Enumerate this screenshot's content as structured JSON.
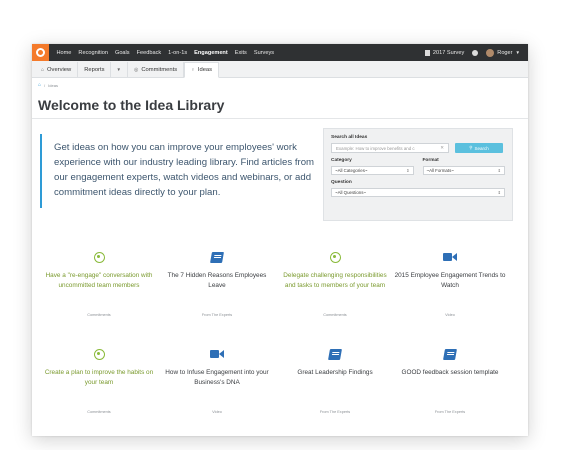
{
  "topbar": {
    "nav": [
      "Home",
      "Recognition",
      "Goals",
      "Feedback",
      "1-on-1s",
      "Engagement",
      "Exits",
      "Surveys"
    ],
    "active": "Engagement",
    "survey_label": "2017 Survey",
    "user_name": "Roger"
  },
  "tabs": {
    "overview": "Overview",
    "reports": "Reports",
    "commitments": "Commitments",
    "ideas": "Ideas"
  },
  "breadcrumb": {
    "current": "Ideas"
  },
  "page": {
    "title": "Welcome to the Idea Library",
    "intro": "Get ideas on how you can improve your employees' work experience with our industry leading library. Find articles from our engagement experts, watch videos and webinars, or add commitment ideas directly to your plan."
  },
  "search": {
    "label": "Search all Ideas",
    "placeholder": "Example: How to improve benefits and c",
    "button": "Search",
    "category_label": "Category",
    "category_value": "~All Categories~",
    "format_label": "Format",
    "format_value": "~All Formats~",
    "question_label": "Question",
    "question_value": "~All Questions~"
  },
  "cards": [
    {
      "icon": "target-icon",
      "title": "Have a \"re-engage\" conversation with uncommitted team members",
      "category": "Commitments",
      "style": "green"
    },
    {
      "icon": "book-icon",
      "title": "The 7 Hidden Reasons Employees Leave",
      "category": "From The Experts",
      "style": "dark"
    },
    {
      "icon": "target-icon",
      "title": "Delegate challenging responsibilities and tasks to members of your team",
      "category": "Commitments",
      "style": "green"
    },
    {
      "icon": "video-camera-icon",
      "title": "2015 Employee Engagement Trends to Watch",
      "category": "Video",
      "style": "dark"
    },
    {
      "icon": "target-icon",
      "title": "Create a plan to improve the habits on your team",
      "category": "Commitments",
      "style": "green"
    },
    {
      "icon": "video-camera-icon",
      "title": "How to Infuse Engagement into your Business's DNA",
      "category": "Video",
      "style": "dark"
    },
    {
      "icon": "book-icon",
      "title": "Great Leadership Findings",
      "category": "From The Experts",
      "style": "dark"
    },
    {
      "icon": "book-icon",
      "title": "GOOD feedback session template",
      "category": "From The Experts",
      "style": "dark"
    }
  ]
}
